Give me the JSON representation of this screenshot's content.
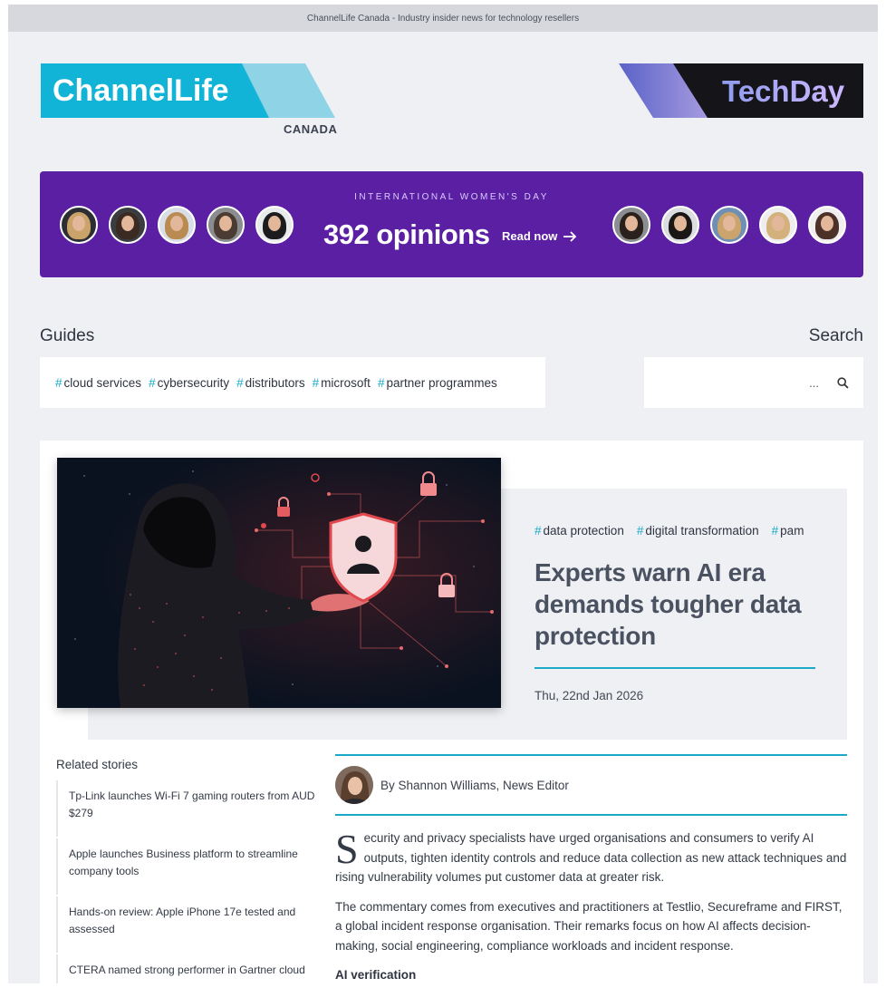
{
  "topbar": {
    "title": "ChannelLife Canada - Industry insider news for technology resellers"
  },
  "brand": {
    "logo_text": "ChannelLife",
    "country": "CANADA",
    "partner_logo_text": "TechDay",
    "accent": "#1aa9c9",
    "banner_color": "#5a1fa3"
  },
  "banner": {
    "kicker": "INTERNATIONAL WOMEN'S DAY",
    "count": "392 opinions",
    "read_label": "Read now"
  },
  "guides": {
    "title": "Guides",
    "tags": [
      "cloud services",
      "cybersecurity",
      "distributors",
      "microsoft",
      "partner programmes"
    ]
  },
  "search": {
    "title": "Search",
    "placeholder": "..."
  },
  "article": {
    "tags": [
      "data protection",
      "digital transformation",
      "pam"
    ],
    "headline": "Experts warn AI era demands tougher data protection",
    "date": "Thu, 22nd Jan 2026",
    "byline": "By Shannon Williams, News Editor",
    "dropcap": "S",
    "para1": "ecurity and privacy specialists have urged organisations and consumers to verify AI outputs, tighten identity controls and reduce data collection as new attack techniques and rising vulnerability volumes put customer data at greater risk.",
    "para2": "The commentary comes from executives and practitioners at Testlio, Secureframe and FIRST, a global incident response organisation. Their remarks focus on how AI affects decision-making, social engineering, compliance workloads and incident response.",
    "subhead": "AI verification"
  },
  "related": {
    "title": "Related stories",
    "items": [
      "Tp-Link launches Wi-Fi 7 gaming routers from AUD $279",
      "Apple launches Business platform to streamline company tools",
      "Hands-on review: Apple iPhone 17e tested and assessed",
      "CTERA named strong performer in Gartner cloud storage"
    ]
  }
}
